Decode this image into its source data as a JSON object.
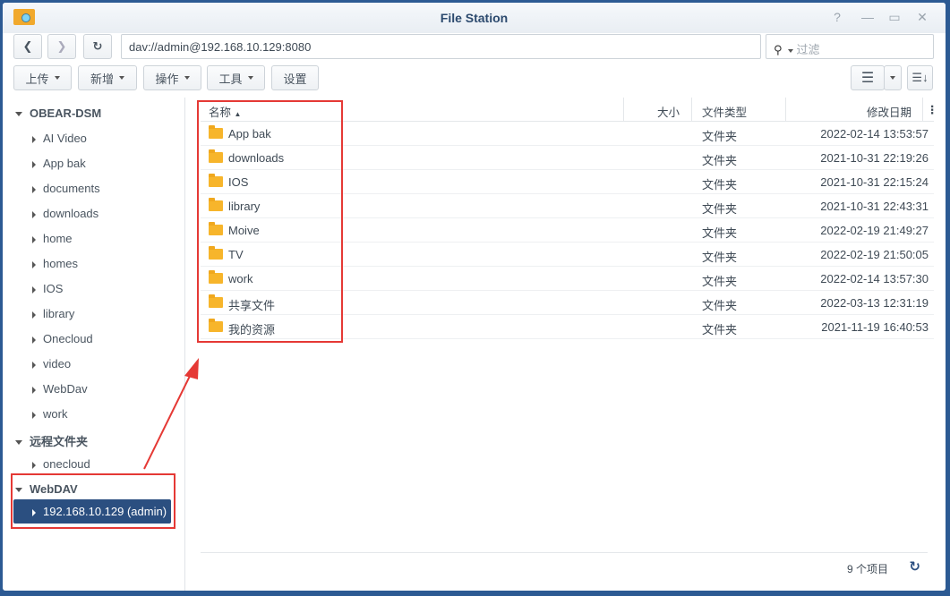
{
  "window": {
    "title": "File Station"
  },
  "toolbar": {
    "path": "dav://admin@192.168.10.129:8080",
    "filter_placeholder": "过滤",
    "upload": "上传",
    "create": "新增",
    "action": "操作",
    "tools": "工具",
    "settings": "设置"
  },
  "sidebar": {
    "group1": "OBEAR-DSM",
    "items": [
      "AI Video",
      "App bak",
      "documents",
      "downloads",
      "home",
      "homes",
      "IOS",
      "library",
      "Onecloud",
      "video",
      "WebDav",
      "work"
    ],
    "group2": "远程文件夹",
    "remote_items": [
      "onecloud"
    ],
    "group3": "WebDAV",
    "selected": "192.168.10.129 (admin)"
  },
  "list": {
    "headers": {
      "name": "名称",
      "size": "大小",
      "type": "文件类型",
      "modified": "修改日期"
    },
    "rows": [
      {
        "name": "App bak",
        "type": "文件夹",
        "modified": "2022-02-14 13:53:57"
      },
      {
        "name": "downloads",
        "type": "文件夹",
        "modified": "2021-10-31 22:19:26"
      },
      {
        "name": "IOS",
        "type": "文件夹",
        "modified": "2021-10-31 22:15:24"
      },
      {
        "name": "library",
        "type": "文件夹",
        "modified": "2021-10-31 22:43:31"
      },
      {
        "name": "Moive",
        "type": "文件夹",
        "modified": "2022-02-19 21:49:27"
      },
      {
        "name": "TV",
        "type": "文件夹",
        "modified": "2022-02-19 21:50:05"
      },
      {
        "name": "work",
        "type": "文件夹",
        "modified": "2022-02-14 13:57:30"
      },
      {
        "name": "共享文件",
        "type": "文件夹",
        "modified": "2022-03-13 12:31:19"
      },
      {
        "name": "我的资源",
        "type": "文件夹",
        "modified": "2021-11-19 16:40:53"
      }
    ],
    "count": "9 个项目"
  },
  "colors": {
    "accent": "#2b4f80",
    "annotation": "#e53935"
  }
}
